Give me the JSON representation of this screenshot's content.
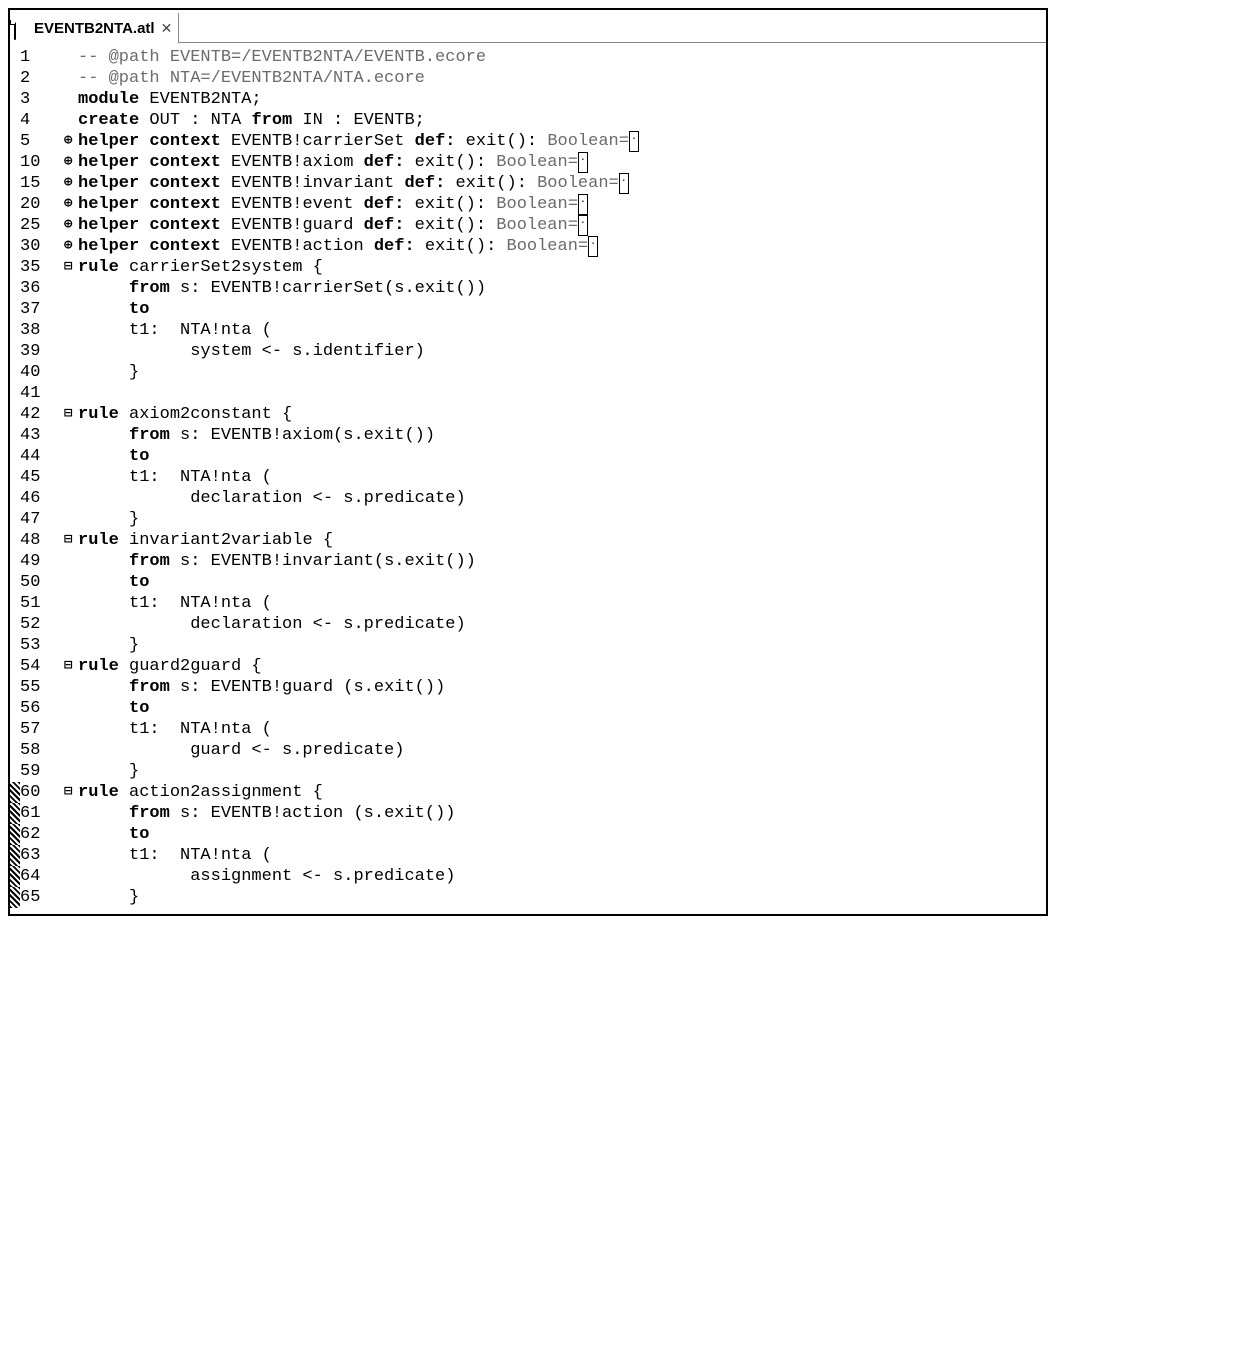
{
  "tab": {
    "title": "EVENTB2NTA.atl"
  },
  "lines": [
    {
      "n": "1",
      "fold": "",
      "chg": false,
      "seg": [
        [
          "dim",
          "-- @path EVENTB=/EVENTB2NTA/EVENTB.ecore"
        ]
      ]
    },
    {
      "n": "2",
      "fold": "",
      "chg": false,
      "seg": [
        [
          "dim",
          "-- @path NTA=/EVENTB2NTA/NTA.ecore"
        ]
      ]
    },
    {
      "n": "3",
      "fold": "",
      "chg": false,
      "seg": [
        [
          "b",
          "module"
        ],
        [
          "",
          " EVENTB2NTA;"
        ]
      ]
    },
    {
      "n": "4",
      "fold": "",
      "chg": false,
      "seg": [
        [
          "b",
          "create"
        ],
        [
          "",
          " OUT : NTA "
        ],
        [
          "b",
          "from"
        ],
        [
          "",
          " IN : EVENTB;"
        ]
      ]
    },
    {
      "n": "5",
      "fold": "plus",
      "chg": false,
      "seg": [
        [
          "b",
          "helper context"
        ],
        [
          "",
          " EVENTB!carrierSet "
        ],
        [
          "b",
          "def:"
        ],
        [
          "",
          " exit(): "
        ],
        [
          "dim",
          "Boolean="
        ],
        [
          "box",
          "."
        ]
      ]
    },
    {
      "n": "10",
      "fold": "plus",
      "chg": false,
      "seg": [
        [
          "b",
          "helper context"
        ],
        [
          "",
          " EVENTB!axiom "
        ],
        [
          "b",
          "def:"
        ],
        [
          "",
          " exit(): "
        ],
        [
          "dim",
          "Boolean="
        ],
        [
          "box",
          "."
        ]
      ]
    },
    {
      "n": "15",
      "fold": "plus",
      "chg": false,
      "seg": [
        [
          "b",
          "helper context"
        ],
        [
          "",
          " EVENTB!invariant "
        ],
        [
          "b",
          "def:"
        ],
        [
          "",
          " exit(): "
        ],
        [
          "dim",
          "Boolean="
        ],
        [
          "box",
          "."
        ]
      ]
    },
    {
      "n": "20",
      "fold": "plus",
      "chg": false,
      "seg": [
        [
          "b",
          "helper context"
        ],
        [
          "",
          " EVENTB!event "
        ],
        [
          "b",
          "def:"
        ],
        [
          "",
          " exit(): "
        ],
        [
          "dim",
          "Boolean="
        ],
        [
          "box",
          "."
        ]
      ]
    },
    {
      "n": "25",
      "fold": "plus",
      "chg": false,
      "seg": [
        [
          "b",
          "helper context"
        ],
        [
          "",
          " EVENTB!guard "
        ],
        [
          "b",
          "def:"
        ],
        [
          "",
          " exit(): "
        ],
        [
          "dim",
          "Boolean="
        ],
        [
          "box",
          "."
        ]
      ]
    },
    {
      "n": "30",
      "fold": "plus",
      "chg": false,
      "seg": [
        [
          "b",
          "helper context"
        ],
        [
          "",
          " EVENTB!action "
        ],
        [
          "b",
          "def:"
        ],
        [
          "",
          " exit(): "
        ],
        [
          "dim",
          "Boolean="
        ],
        [
          "box",
          "."
        ]
      ]
    },
    {
      "n": "35",
      "fold": "minus",
      "chg": false,
      "seg": [
        [
          "b",
          "rule"
        ],
        [
          "",
          " carrierSet2system {"
        ]
      ]
    },
    {
      "n": "36",
      "fold": "",
      "chg": false,
      "seg": [
        [
          "",
          "     "
        ],
        [
          "b",
          "from"
        ],
        [
          "",
          " s: EVENTB!carrierSet(s.exit())"
        ]
      ]
    },
    {
      "n": "37",
      "fold": "",
      "chg": false,
      "seg": [
        [
          "",
          "     "
        ],
        [
          "b",
          "to"
        ]
      ]
    },
    {
      "n": "38",
      "fold": "",
      "chg": false,
      "seg": [
        [
          "",
          "     t1:  NTA!nta ("
        ]
      ]
    },
    {
      "n": "39",
      "fold": "",
      "chg": false,
      "seg": [
        [
          "",
          "           system <- s.identifier)"
        ]
      ]
    },
    {
      "n": "40",
      "fold": "",
      "chg": false,
      "seg": [
        [
          "",
          "     }"
        ]
      ]
    },
    {
      "n": "41",
      "fold": "",
      "chg": false,
      "seg": [
        [
          "",
          ""
        ]
      ]
    },
    {
      "n": "42",
      "fold": "minus",
      "chg": false,
      "seg": [
        [
          "b",
          "rule"
        ],
        [
          "",
          " axiom2constant {"
        ]
      ]
    },
    {
      "n": "43",
      "fold": "",
      "chg": false,
      "seg": [
        [
          "",
          "     "
        ],
        [
          "b",
          "from"
        ],
        [
          "",
          " s: EVENTB!axiom(s.exit())"
        ]
      ]
    },
    {
      "n": "44",
      "fold": "",
      "chg": false,
      "seg": [
        [
          "",
          "     "
        ],
        [
          "b",
          "to"
        ]
      ]
    },
    {
      "n": "45",
      "fold": "",
      "chg": false,
      "seg": [
        [
          "",
          "     t1:  NTA!nta ("
        ]
      ]
    },
    {
      "n": "46",
      "fold": "",
      "chg": false,
      "seg": [
        [
          "",
          "           declaration <- s.predicate)"
        ]
      ]
    },
    {
      "n": "47",
      "fold": "",
      "chg": false,
      "seg": [
        [
          "",
          "     }"
        ]
      ]
    },
    {
      "n": "48",
      "fold": "minus",
      "chg": false,
      "seg": [
        [
          "b",
          "rule"
        ],
        [
          "",
          " invariant2variable {"
        ]
      ]
    },
    {
      "n": "49",
      "fold": "",
      "chg": false,
      "seg": [
        [
          "",
          "     "
        ],
        [
          "b",
          "from"
        ],
        [
          "",
          " s: EVENTB!invariant(s.exit())"
        ]
      ]
    },
    {
      "n": "50",
      "fold": "",
      "chg": false,
      "seg": [
        [
          "",
          "     "
        ],
        [
          "b",
          "to"
        ]
      ]
    },
    {
      "n": "51",
      "fold": "",
      "chg": false,
      "seg": [
        [
          "",
          "     t1:  NTA!nta ("
        ]
      ]
    },
    {
      "n": "52",
      "fold": "",
      "chg": false,
      "seg": [
        [
          "",
          "           declaration <- s.predicate)"
        ]
      ]
    },
    {
      "n": "53",
      "fold": "",
      "chg": false,
      "seg": [
        [
          "",
          "     }"
        ]
      ]
    },
    {
      "n": "54",
      "fold": "minus",
      "chg": false,
      "seg": [
        [
          "b",
          "rule"
        ],
        [
          "",
          " guard2guard {"
        ]
      ]
    },
    {
      "n": "55",
      "fold": "",
      "chg": false,
      "seg": [
        [
          "",
          "     "
        ],
        [
          "b",
          "from"
        ],
        [
          "",
          " s: EVENTB!guard (s.exit())"
        ]
      ]
    },
    {
      "n": "56",
      "fold": "",
      "chg": false,
      "seg": [
        [
          "",
          "     "
        ],
        [
          "b",
          "to"
        ]
      ]
    },
    {
      "n": "57",
      "fold": "",
      "chg": false,
      "seg": [
        [
          "",
          "     t1:  NTA!nta ("
        ]
      ]
    },
    {
      "n": "58",
      "fold": "",
      "chg": false,
      "seg": [
        [
          "",
          "           guard <- s.predicate)"
        ]
      ]
    },
    {
      "n": "59",
      "fold": "",
      "chg": false,
      "seg": [
        [
          "",
          "     }"
        ]
      ]
    },
    {
      "n": "60",
      "fold": "minus",
      "chg": true,
      "seg": [
        [
          "b",
          "rule"
        ],
        [
          "",
          " action2assignment {"
        ]
      ]
    },
    {
      "n": "61",
      "fold": "",
      "chg": true,
      "seg": [
        [
          "",
          "     "
        ],
        [
          "b",
          "from"
        ],
        [
          "",
          " s: EVENTB!action (s.exit())"
        ]
      ]
    },
    {
      "n": "62",
      "fold": "",
      "chg": true,
      "seg": [
        [
          "",
          "     "
        ],
        [
          "b",
          "to"
        ]
      ]
    },
    {
      "n": "63",
      "fold": "",
      "chg": true,
      "seg": [
        [
          "",
          "     t1:  NTA!nta ("
        ]
      ]
    },
    {
      "n": "64",
      "fold": "",
      "chg": true,
      "seg": [
        [
          "",
          "           assignment <- s.predicate)"
        ]
      ]
    },
    {
      "n": "65",
      "fold": "",
      "chg": true,
      "seg": [
        [
          "",
          "     }"
        ]
      ]
    }
  ]
}
